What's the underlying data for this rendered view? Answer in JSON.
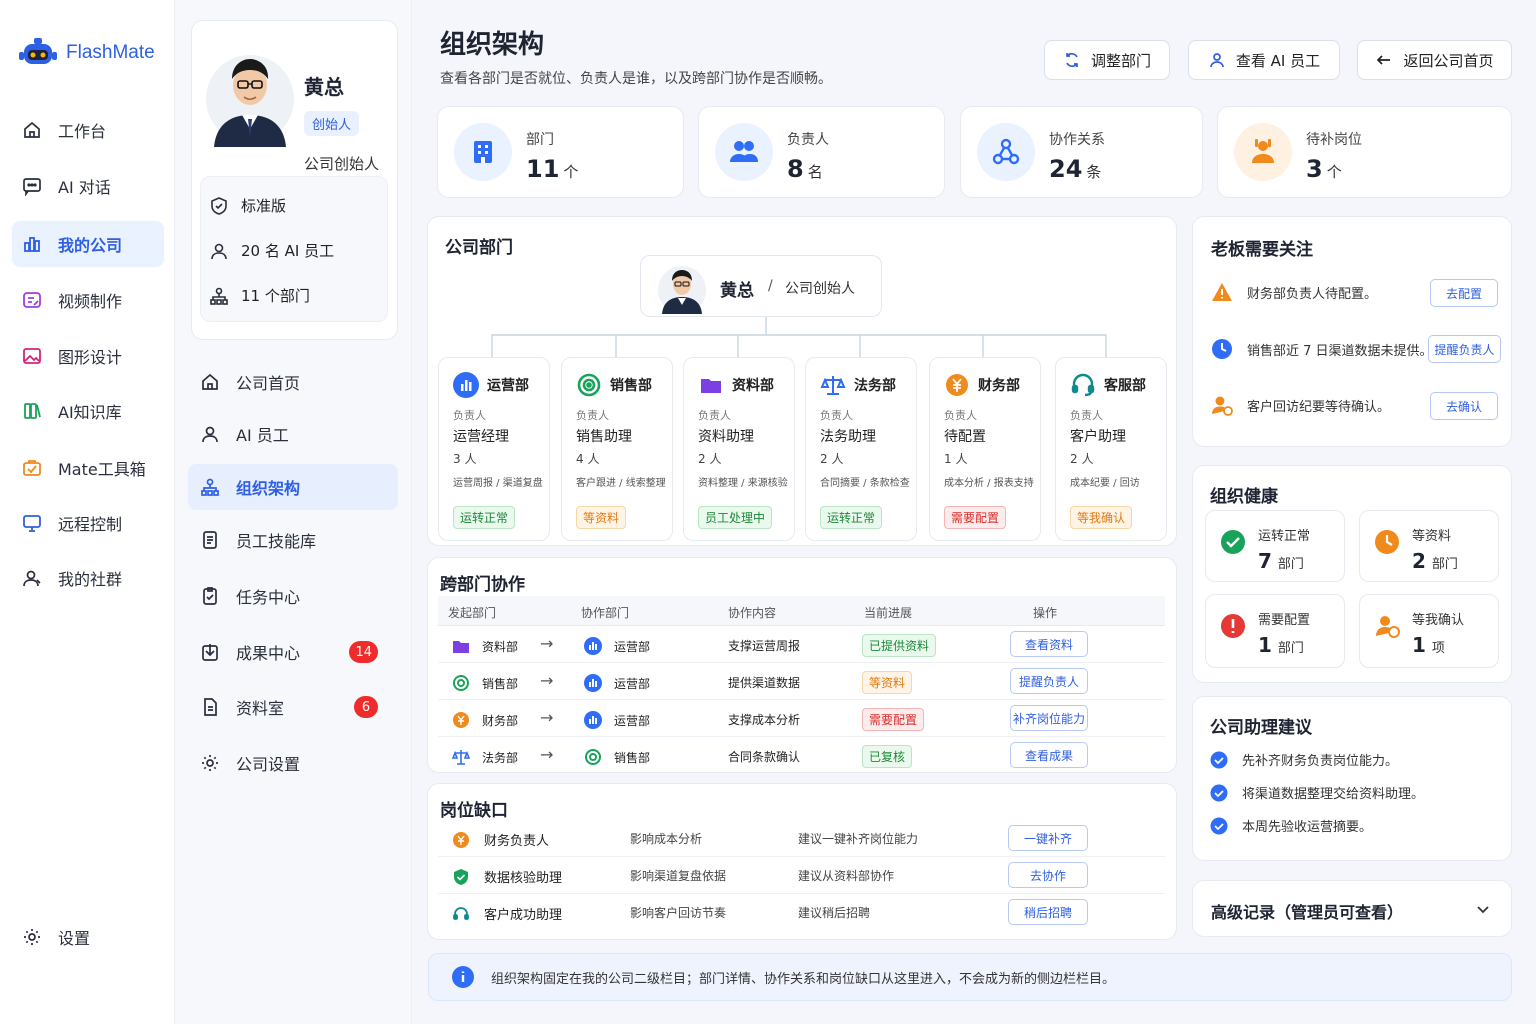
{
  "app": {
    "name": "FlashMate"
  },
  "sidebar": {
    "items": [
      {
        "label": "工作台"
      },
      {
        "label": "AI 对话"
      },
      {
        "label": "我的公司"
      },
      {
        "label": "视频制作"
      },
      {
        "label": "图形设计"
      },
      {
        "label": "AI知识库"
      },
      {
        "label": "Mate工具箱"
      },
      {
        "label": "远程控制"
      },
      {
        "label": "我的社群"
      }
    ],
    "settings": "设置"
  },
  "profile": {
    "name": "黄总",
    "badge": "创始人",
    "role": "公司创始人",
    "plan": "标准版",
    "employees": "20 名 AI 员工",
    "departments": "11 个部门"
  },
  "submenu": {
    "items": [
      {
        "label": "公司首页"
      },
      {
        "label": "AI 员工"
      },
      {
        "label": "组织架构"
      },
      {
        "label": "员工技能库"
      },
      {
        "label": "任务中心"
      },
      {
        "label": "成果中心",
        "badge": "14"
      },
      {
        "label": "资料室",
        "badge": "6"
      },
      {
        "label": "公司设置"
      }
    ]
  },
  "page": {
    "title": "组织架构",
    "subtitle": "查看各部门是否就位、负责人是谁，以及跨部门协作是否顺畅。",
    "actions": {
      "adjust": "调整部门",
      "view_ai": "查看 AI 员工",
      "back": "返回公司首页"
    }
  },
  "stats": [
    {
      "label": "部门",
      "value": "11",
      "unit": "个",
      "color": "#2f6df6"
    },
    {
      "label": "负责人",
      "value": "8",
      "unit": "名",
      "color": "#2f6df6"
    },
    {
      "label": "协作关系",
      "value": "24",
      "unit": "条",
      "color": "#2f6df6"
    },
    {
      "label": "待补岗位",
      "value": "3",
      "unit": "个",
      "color": "#f08a1c"
    }
  ],
  "departments_panel": {
    "title": "公司部门",
    "root": {
      "name": "黄总",
      "sep": "/",
      "role": "公司创始人"
    },
    "lead_label": "负责人",
    "items": [
      {
        "name": "运营部",
        "manager": "运营经理",
        "count": "3 人",
        "desc": "运营周报 / 渠道复盘",
        "status": "运转正常",
        "status_type": "green",
        "icon": "chart-icon",
        "color": "#2f6df6"
      },
      {
        "name": "销售部",
        "manager": "销售助理",
        "count": "4 人",
        "desc": "客户跟进 / 线索整理",
        "status": "等资料",
        "status_type": "orange",
        "icon": "target-icon",
        "color": "#19a35a"
      },
      {
        "name": "资料部",
        "manager": "资料助理",
        "count": "2 人",
        "desc": "资料整理 / 来源核验",
        "status": "员工处理中",
        "status_type": "green",
        "icon": "folder-icon",
        "color": "#7b3fe4"
      },
      {
        "name": "法务部",
        "manager": "法务助理",
        "count": "2 人",
        "desc": "合同摘要 / 条款检查",
        "status": "运转正常",
        "status_type": "green",
        "icon": "scale-icon",
        "color": "#2f6df6"
      },
      {
        "name": "财务部",
        "manager": "待配置",
        "count": "1 人",
        "desc": "成本分析 / 报表支持",
        "status": "需要配置",
        "status_type": "red",
        "icon": "yen-icon",
        "color": "#f08a1c"
      },
      {
        "name": "客服部",
        "manager": "客户助理",
        "count": "2 人",
        "desc": "成本纪要 / 回访",
        "status": "等我确认",
        "status_type": "orange",
        "icon": "headset-icon",
        "color": "#0f8b8d"
      }
    ]
  },
  "collab": {
    "title": "跨部门协作",
    "headers": [
      "发起部门",
      "协作部门",
      "协作内容",
      "当前进展",
      "操作"
    ],
    "rows": [
      {
        "from": "资料部",
        "to": "运营部",
        "content": "支撑运营周报",
        "status": "已提供资料",
        "status_type": "green",
        "action": "查看资料"
      },
      {
        "from": "销售部",
        "to": "运营部",
        "content": "提供渠道数据",
        "status": "等资料",
        "status_type": "orange",
        "action": "提醒负责人"
      },
      {
        "from": "财务部",
        "to": "运营部",
        "content": "支撑成本分析",
        "status": "需要配置",
        "status_type": "red",
        "action": "补齐岗位能力"
      },
      {
        "from": "法务部",
        "to": "销售部",
        "content": "合同条款确认",
        "status": "已复核",
        "status_type": "green",
        "action": "查看成果"
      }
    ]
  },
  "gaps": {
    "title": "岗位缺口",
    "rows": [
      {
        "role": "财务负责人",
        "impact": "影响成本分析",
        "suggest": "建议一键补齐岗位能力",
        "action": "一键补齐"
      },
      {
        "role": "数据核验助理",
        "impact": "影响渠道复盘依据",
        "suggest": "建议从资料部协作",
        "action": "去协作"
      },
      {
        "role": "客户成功助理",
        "impact": "影响客户回访节奏",
        "suggest": "建议稍后招聘",
        "action": "稍后招聘"
      }
    ]
  },
  "attention": {
    "title": "老板需要关注",
    "items": [
      {
        "text": "财务部负责人待配置。",
        "action": "去配置"
      },
      {
        "text": "销售部近 7 日渠道数据未提供。",
        "action": "提醒负责人"
      },
      {
        "text": "客户回访纪要等待确认。",
        "action": "去确认"
      }
    ]
  },
  "health": {
    "title": "组织健康",
    "cards": [
      {
        "label": "运转正常",
        "value": "7",
        "unit": "部门",
        "color": "#19a35a"
      },
      {
        "label": "等资料",
        "value": "2",
        "unit": "部门",
        "color": "#f08a1c"
      },
      {
        "label": "需要配置",
        "value": "1",
        "unit": "部门",
        "color": "#e53935"
      },
      {
        "label": "等我确认",
        "value": "1",
        "unit": "项",
        "color": "#f08a1c"
      }
    ]
  },
  "suggestions": {
    "title": "公司助理建议",
    "items": [
      "先补齐财务负责岗位能力。",
      "将渠道数据整理交给资料助理。",
      "本周先验收运营摘要。"
    ]
  },
  "advanced": {
    "title": "高级记录（管理员可查看）"
  },
  "footer": {
    "note": "组织架构固定在我的公司二级栏目；部门详情、协作关系和岗位缺口从这里进入，不会成为新的侧边栏栏目。"
  }
}
